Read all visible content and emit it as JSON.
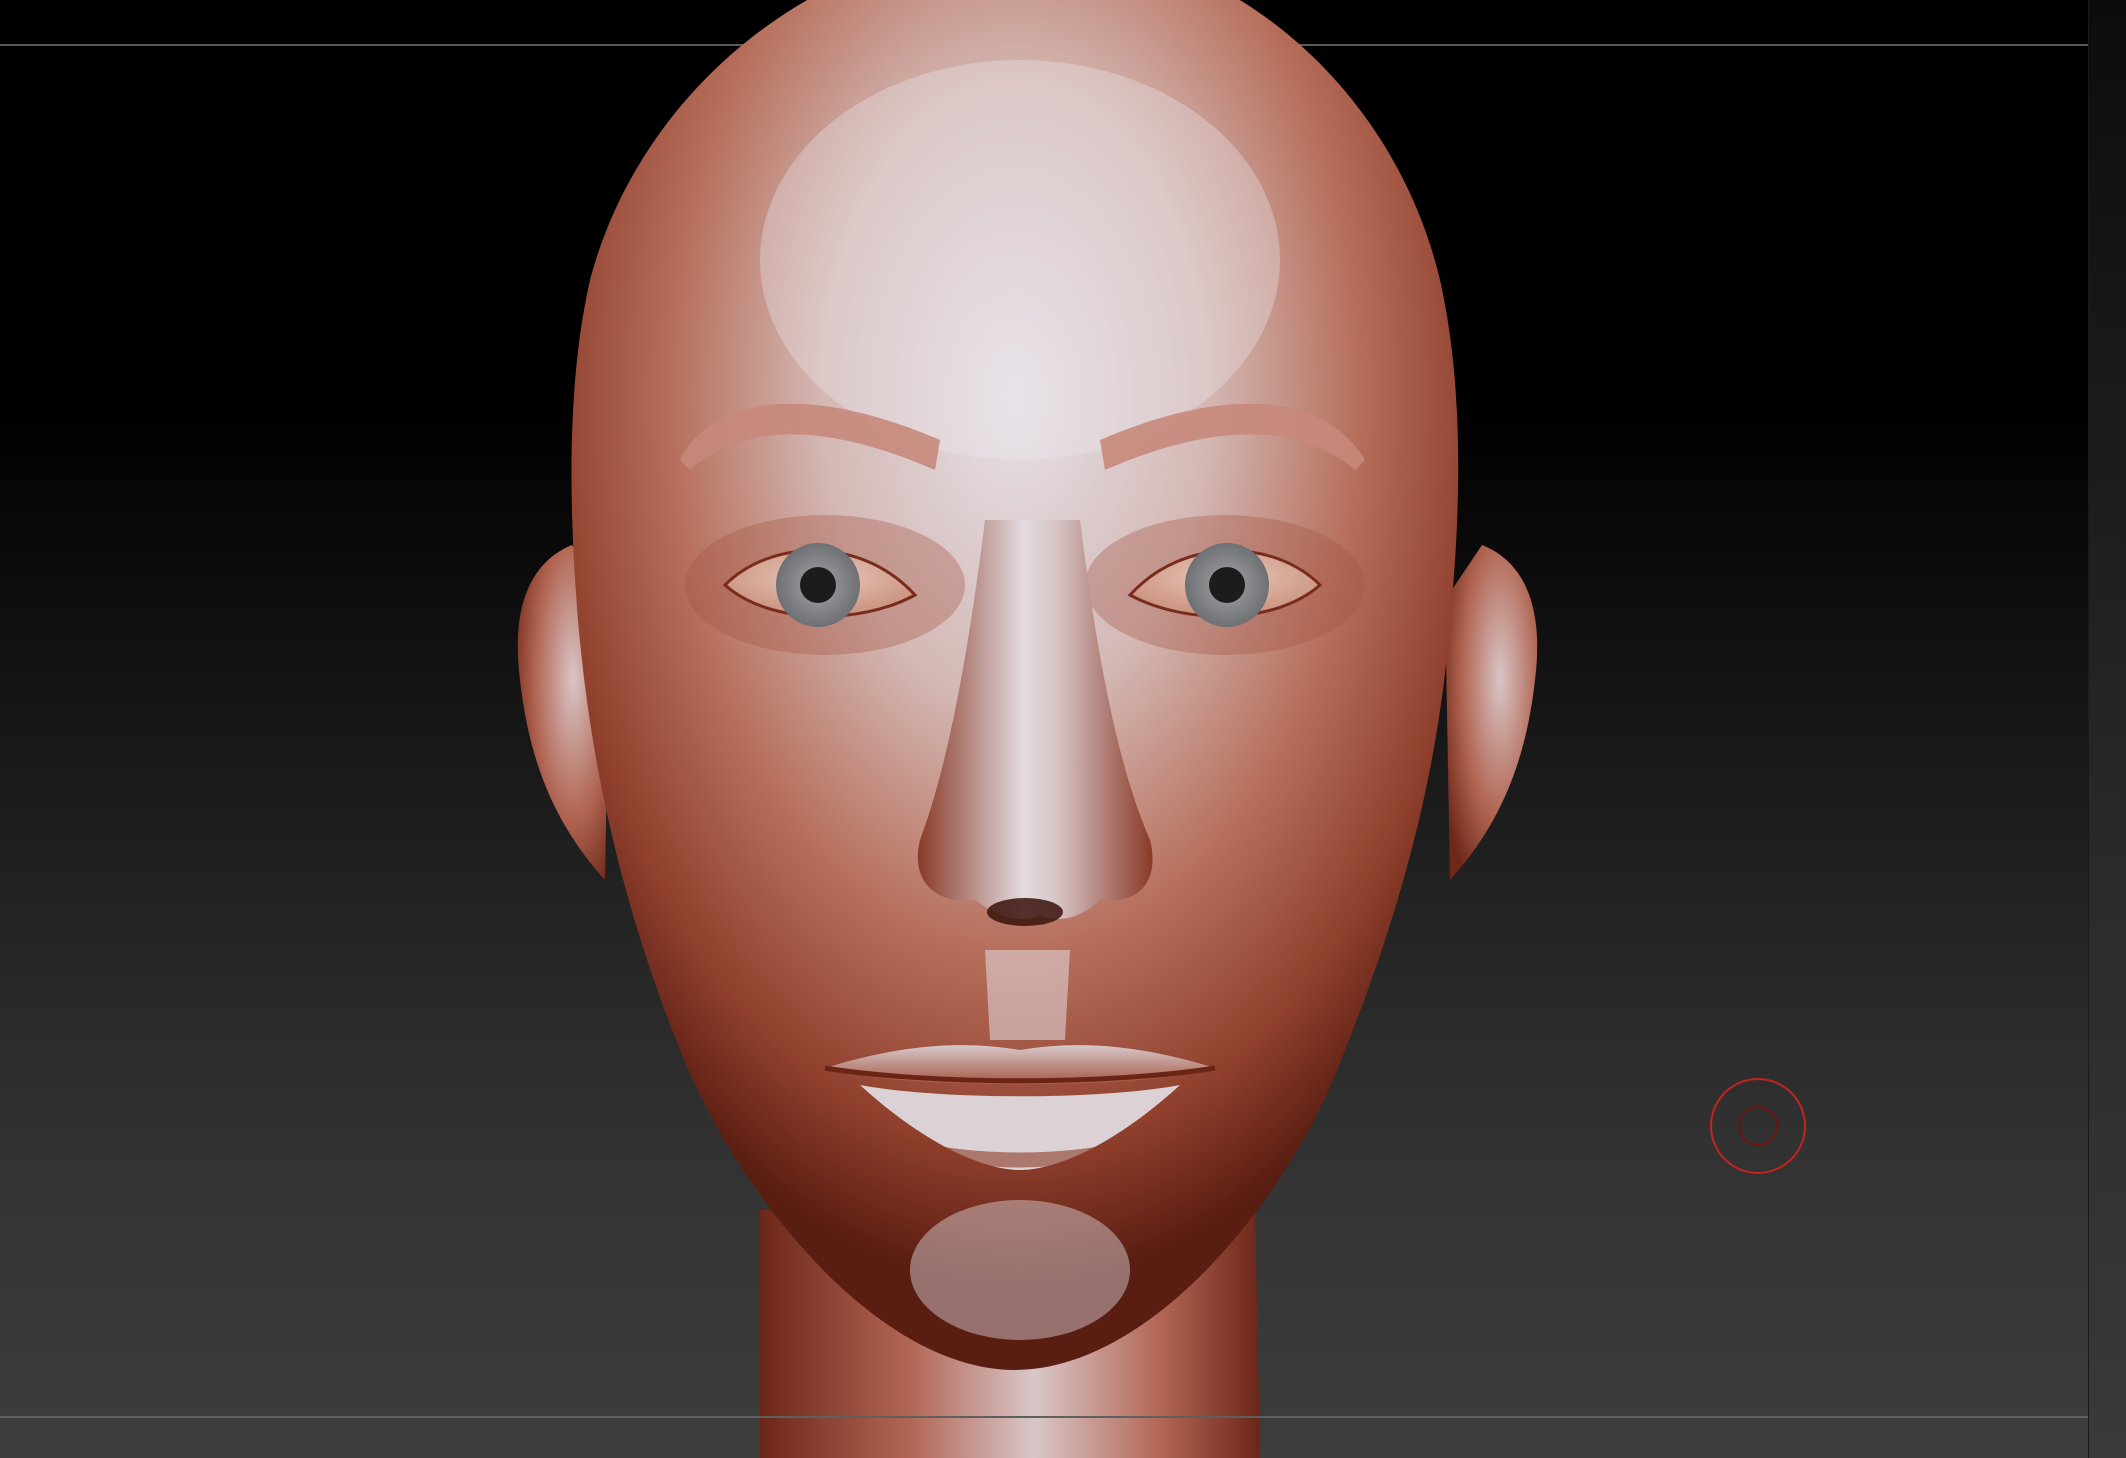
{
  "viewport": {
    "background_top": "#000000",
    "background_bottom": "#3d3d3d",
    "frame_line_color": "#5b5b5b"
  },
  "model": {
    "subject": "sculpted-head",
    "material_base": "#b4614e",
    "material_highlight": "#ded9df",
    "material_shadow": "#5a1d12",
    "iris_color": "#8d8f93",
    "pupil_color": "#1c1c1c"
  },
  "brush_cursor": {
    "outer_color": "#c2241f",
    "inner_color": "#6a1512"
  }
}
